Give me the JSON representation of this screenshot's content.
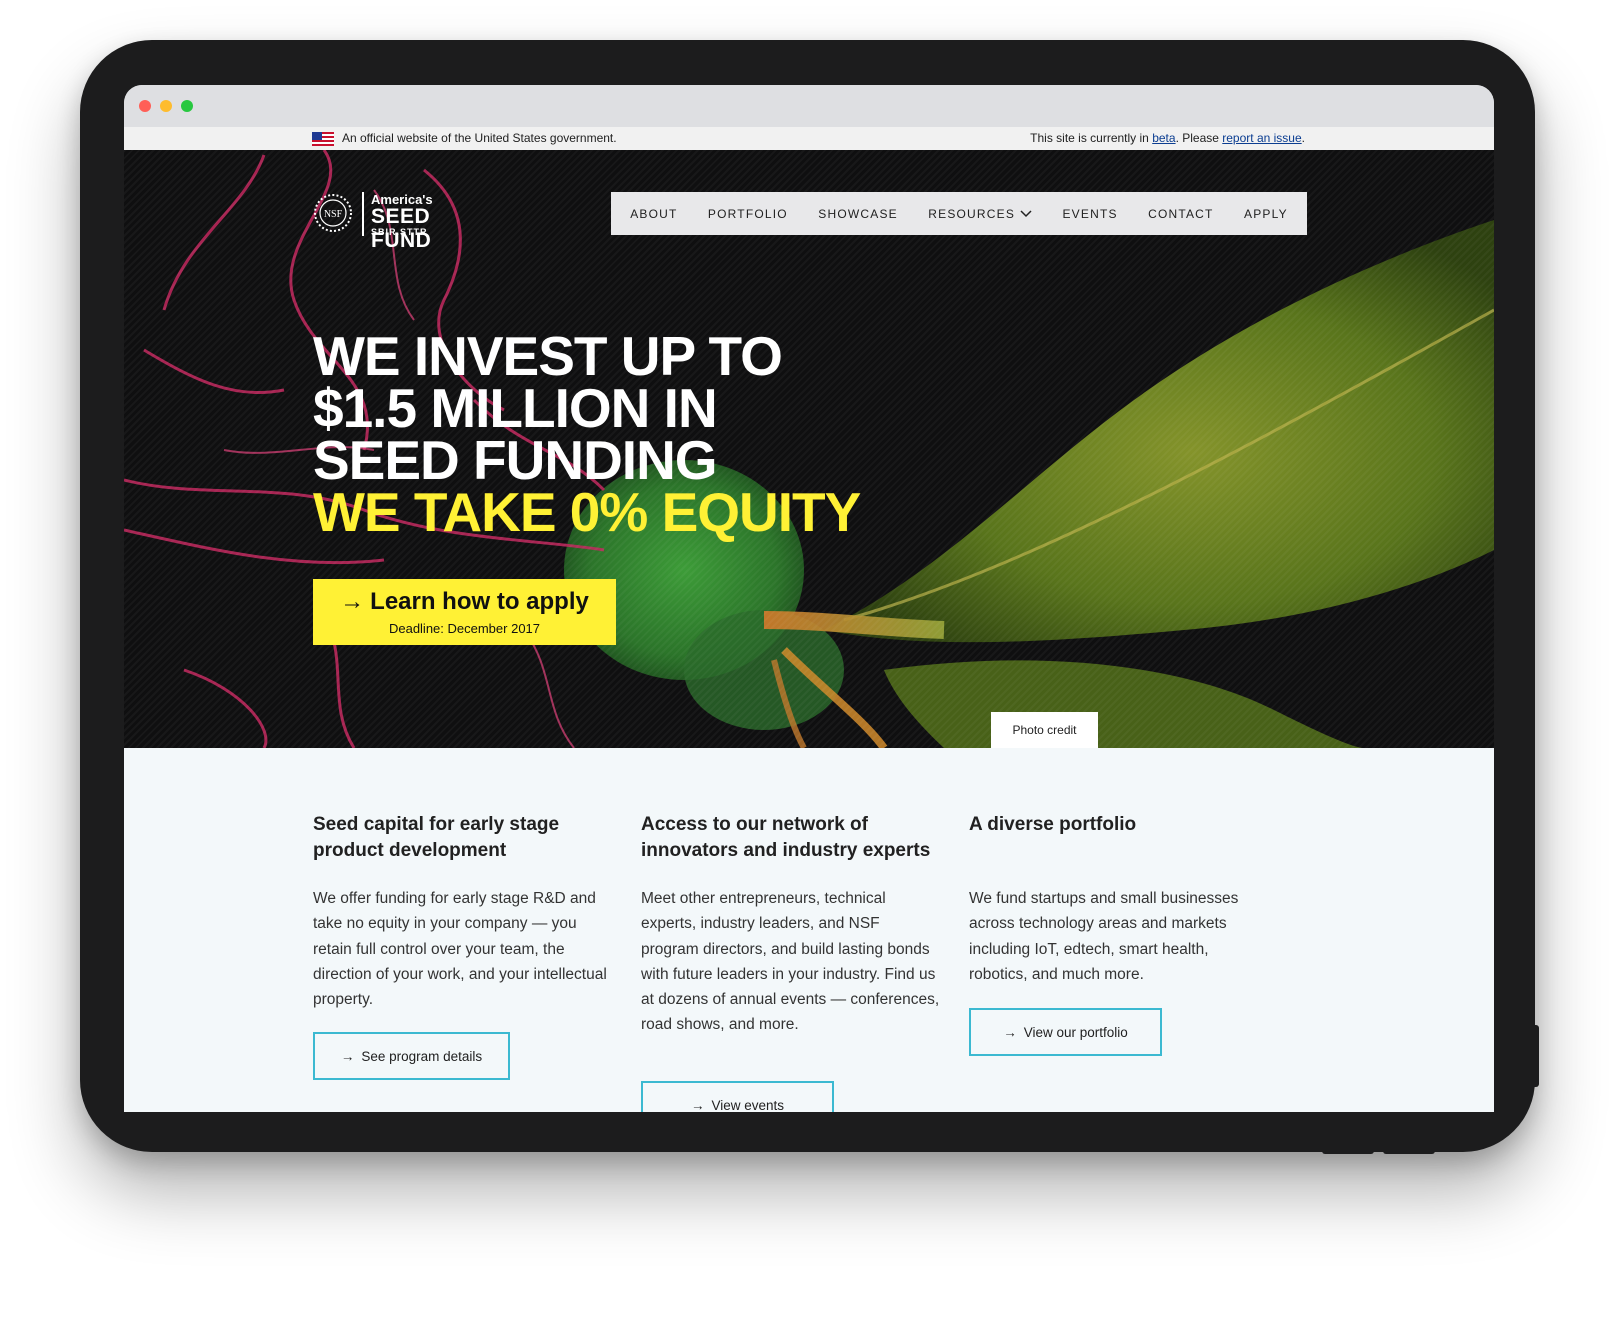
{
  "gov_banner": {
    "official_text": "An official website of the United States government.",
    "beta_prefix": "This site is currently in ",
    "beta_link": "beta",
    "beta_middle": ". Please ",
    "report_link": "report an issue",
    "beta_suffix": "."
  },
  "logo": {
    "seal_text": "NSF",
    "line1": "America's",
    "line2": "SEED FUND",
    "line3": "SBIR.STTR"
  },
  "nav": {
    "items": [
      {
        "label": "ABOUT"
      },
      {
        "label": "PORTFOLIO"
      },
      {
        "label": "SHOWCASE"
      },
      {
        "label": "RESOURCES",
        "has_dropdown": true
      },
      {
        "label": "EVENTS"
      },
      {
        "label": "CONTACT"
      },
      {
        "label": "APPLY"
      }
    ]
  },
  "hero": {
    "headline_lines": [
      "WE INVEST UP TO",
      "$1.5 MILLION IN",
      "SEED FUNDING"
    ],
    "headline_highlight": "WE TAKE 0% EQUITY",
    "cta_arrow": "→",
    "cta_label": "Learn how to apply",
    "cta_deadline": "Deadline: December 2017",
    "photo_credit": "Photo credit"
  },
  "features": [
    {
      "title": "Seed capital for early stage product development",
      "body": "We offer funding for early stage R&D and take no equity in your company — you retain full control over your team, the direction of your work, and your intellectual property.",
      "button_arrow": "→",
      "button_label": "See program details"
    },
    {
      "title": "Access to our network of innovators and industry experts",
      "body": "Meet other entrepreneurs, technical experts, industry leaders, and NSF program directors, and build lasting bonds with future leaders in your industry. Find us at dozens of annual events — conferences, road shows, and more.",
      "button_arrow": "→",
      "button_label": "View events"
    },
    {
      "title": "A diverse portfolio",
      "body": "We fund startups and small businesses across technology areas and markets including IoT, edtech, smart health, robotics, and much more.",
      "button_arrow": "→",
      "button_label": "View our portfolio"
    }
  ],
  "colors": {
    "accent_yellow": "#fff135",
    "outline_button": "#3bb9d1",
    "content_bg": "#f3f8fa",
    "hero_bg": "#0f0f10",
    "link_blue": "#0b3d91"
  }
}
